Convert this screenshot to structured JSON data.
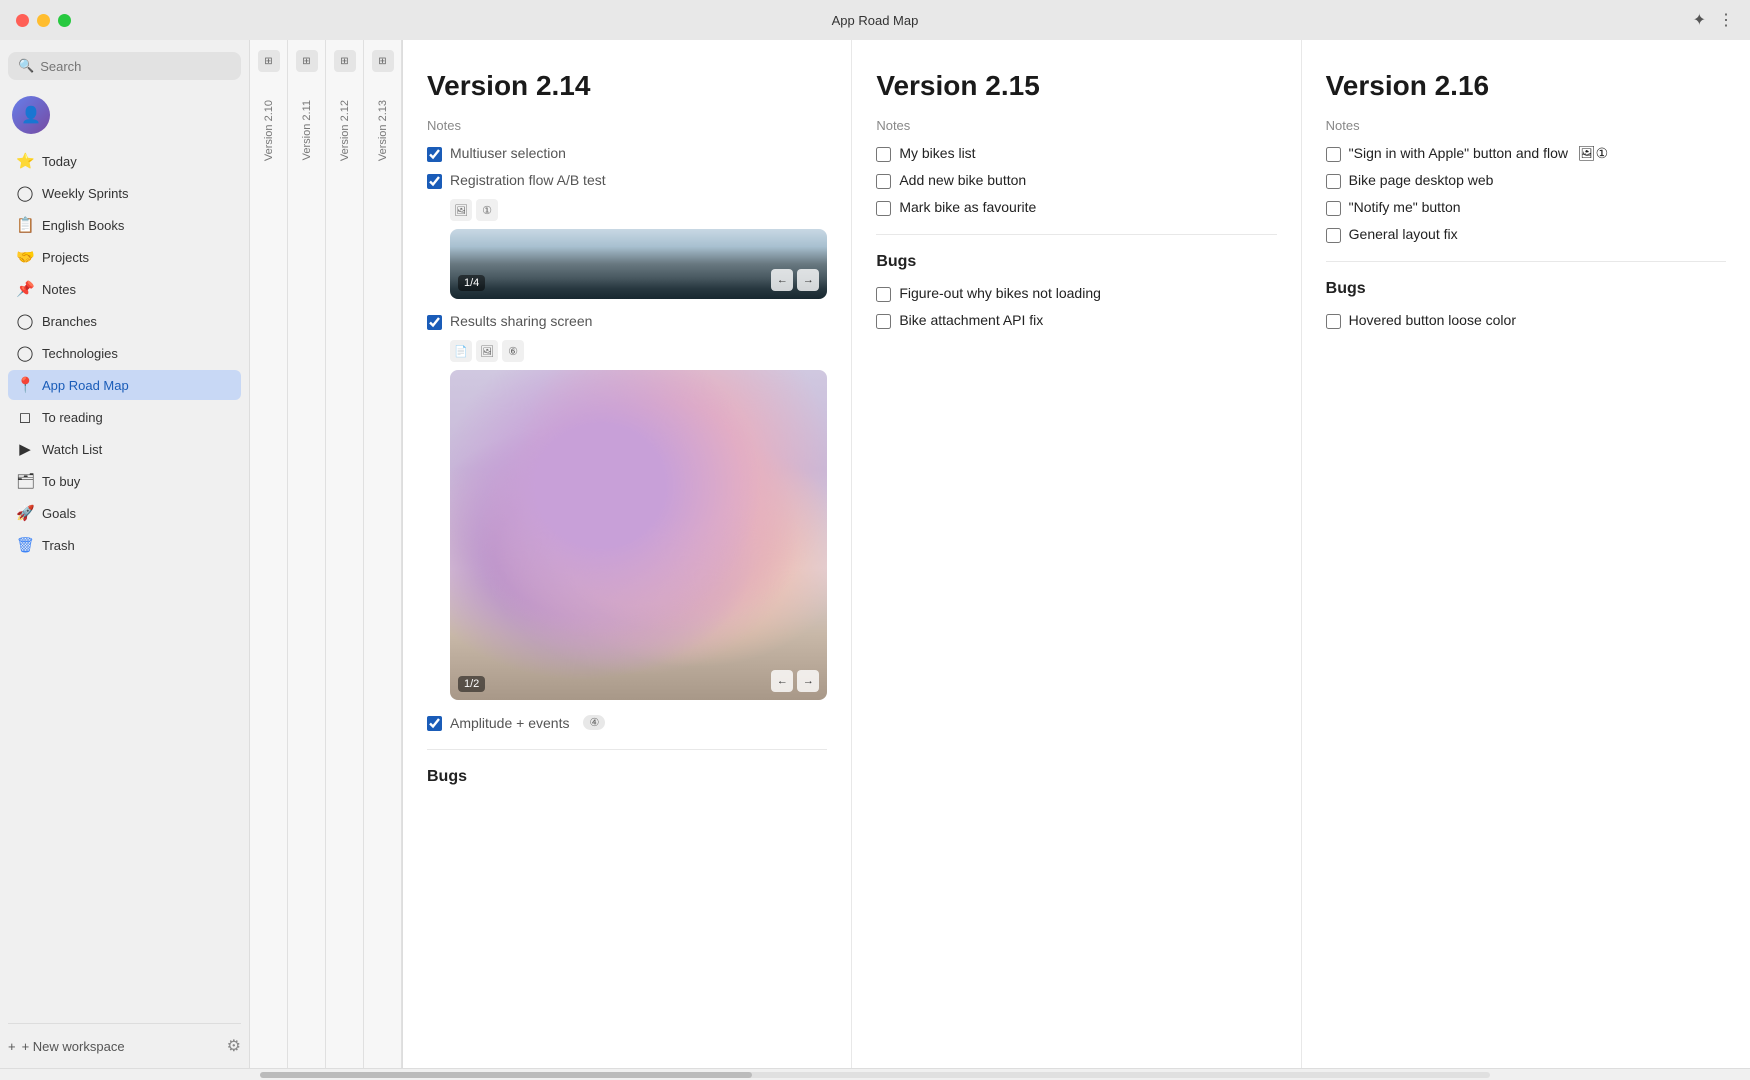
{
  "titleBar": {
    "title": "App Road Map",
    "trafficLights": [
      "red",
      "yellow",
      "green"
    ]
  },
  "sidebar": {
    "searchPlaceholder": "Search",
    "navItems": [
      {
        "id": "today",
        "label": "Today",
        "icon": "⭐",
        "iconClass": "star-icon"
      },
      {
        "id": "weekly-sprints",
        "label": "Weekly Sprints",
        "icon": "◯"
      },
      {
        "id": "english-books",
        "label": "English Books",
        "icon": "📋"
      },
      {
        "id": "projects",
        "label": "Projects",
        "icon": "🤝"
      },
      {
        "id": "notes",
        "label": "Notes",
        "icon": "📌"
      },
      {
        "id": "branches",
        "label": "Branches",
        "icon": "◯"
      },
      {
        "id": "technologies",
        "label": "Technologies",
        "icon": "◯"
      },
      {
        "id": "app-road-map",
        "label": "App Road Map",
        "icon": "📍",
        "active": true
      },
      {
        "id": "to-reading",
        "label": "To reading",
        "icon": "◻"
      },
      {
        "id": "watch-list",
        "label": "Watch List",
        "icon": "▶"
      },
      {
        "id": "to-buy",
        "label": "To buy",
        "icon": "🗂"
      },
      {
        "id": "goals",
        "label": "Goals",
        "icon": "🚀"
      },
      {
        "id": "trash",
        "label": "Trash",
        "icon": "🗑"
      }
    ],
    "newWorkspace": "+ New workspace"
  },
  "versionTabs": [
    {
      "label": "Version 2.10"
    },
    {
      "label": "Version 2.11"
    },
    {
      "label": "Version 2.12"
    },
    {
      "label": "Version 2.13"
    }
  ],
  "versions": [
    {
      "id": "v214",
      "title": "Version 2.14",
      "notesLabel": "Notes",
      "checklist": [
        {
          "text": "Multiuser selection",
          "checked": true
        },
        {
          "text": "Registration flow A/B test",
          "checked": true,
          "hasIcons": true,
          "icons": [
            "🖼",
            "①"
          ],
          "carousel": {
            "type": "forest",
            "counter": "1/4"
          }
        },
        {
          "text": "Results sharing screen",
          "checked": true,
          "hasIcons": true,
          "icons": [
            "📄",
            "🖼",
            "⑥"
          ],
          "carousel": {
            "type": "flowers",
            "counter": "1/2"
          }
        },
        {
          "text": "Amplitude + events",
          "checked": true,
          "badge": "④"
        }
      ],
      "bugsLabel": "Bugs",
      "bugs": []
    },
    {
      "id": "v215",
      "title": "Version 2.15",
      "notesLabel": "Notes",
      "checklist": [
        {
          "text": "My bikes list",
          "checked": false
        },
        {
          "text": "Add new bike button",
          "checked": false
        },
        {
          "text": "Mark bike as favourite",
          "checked": false
        }
      ],
      "bugsLabel": "Bugs",
      "bugs": [
        {
          "text": "Figure-out why bikes not loading",
          "checked": false
        },
        {
          "text": "Bike attachment API fix",
          "checked": false
        }
      ]
    },
    {
      "id": "v216",
      "title": "Version 2.16",
      "notesLabel": "Notes",
      "checklist": [
        {
          "text": "\"Sign in with Apple\" button and flow",
          "checked": false,
          "hasIcons": true,
          "icons": [
            "🖼",
            "①"
          ]
        },
        {
          "text": "Bike page desktop web",
          "checked": false
        },
        {
          "text": "\"Notify me\" button",
          "checked": false
        },
        {
          "text": "General layout fix",
          "checked": false
        }
      ],
      "bugsLabel": "Bugs",
      "bugs": [
        {
          "text": "Hovered button loose color",
          "checked": false
        }
      ]
    }
  ]
}
